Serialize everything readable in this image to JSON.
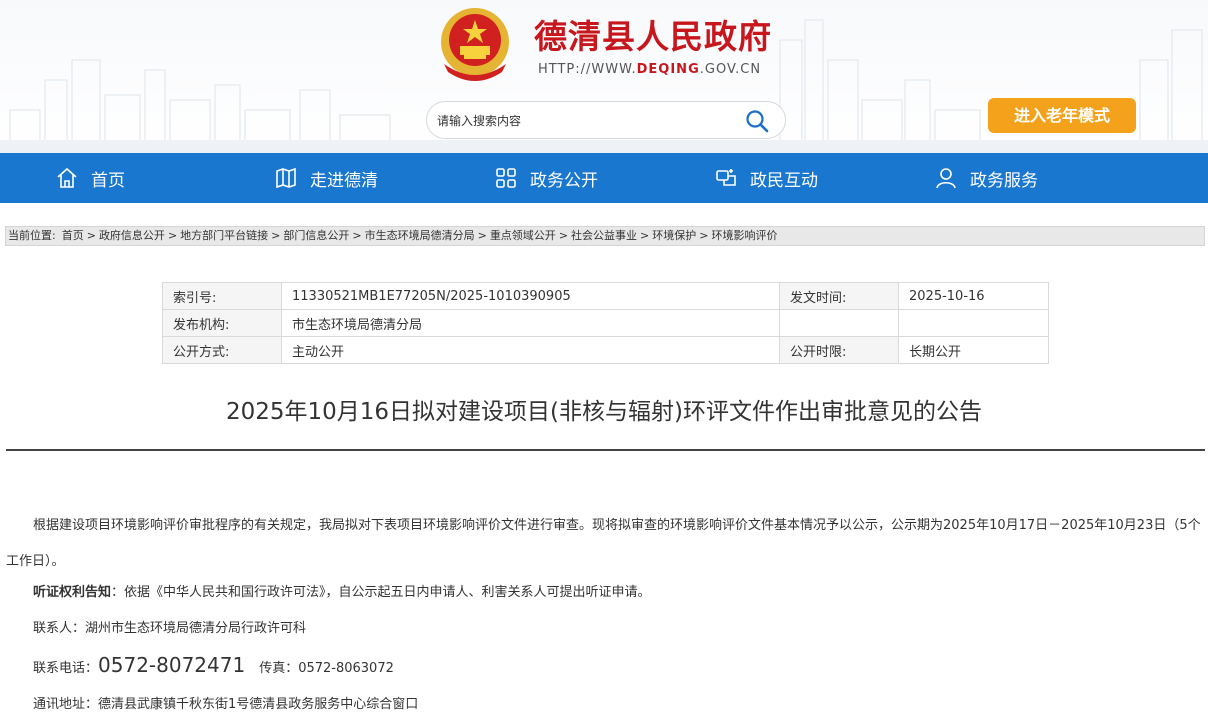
{
  "header": {
    "site_title": "德清县人民政府",
    "url_prefix": "HTTP://WWW.",
    "url_brand": "DEQING",
    "url_suffix": ".GOV.CN",
    "search_placeholder": "请输入搜索内容",
    "elder_mode": "进入老年模式"
  },
  "nav": {
    "items": [
      {
        "label": "首页",
        "icon": "home-icon"
      },
      {
        "label": "走进德清",
        "icon": "map-icon"
      },
      {
        "label": "政务公开",
        "icon": "grid-icon"
      },
      {
        "label": "政民互动",
        "icon": "interact-icon"
      },
      {
        "label": "政务服务",
        "icon": "user-icon"
      }
    ]
  },
  "breadcrumb": {
    "lead": "当前位置:",
    "items": [
      "首页",
      "政府信息公开",
      "地方部门平台链接",
      "部门信息公开",
      "市生态环境局德清分局",
      "重点领域公开",
      "社会公益事业",
      "环境保护",
      "环境影响评价"
    ],
    "separator": ">"
  },
  "info": {
    "index_label": "索引号:",
    "index_value": "11330521MB1E77205N/2025-1010390905",
    "date_label": "发文时间:",
    "date_value": "2025-10-16",
    "org_label": "发布机构:",
    "org_value": "市生态环境局德清分局",
    "mode_label": "公开方式:",
    "mode_value": "主动公开",
    "period_label": "公开时限:",
    "period_value": "长期公开"
  },
  "article": {
    "title": "2025年10月16日拟对建设项目(非核与辐射)环评文件作出审批意见的公告",
    "para1": "根据建设项目环境影响评价审批程序的有关规定，我局拟对下表项目环境影响评价文件进行审查。现将拟审查的环境影响评价文件基本情况予以公示，公示期为2025年10月17日－2025年10月23日（5个工作日）。",
    "hearing_label": "听证权利告知",
    "hearing_text": "：依据《中华人民共和国行政许可法》，自公示起五日内申请人、利害关系人可提出听证申请。",
    "contact": "联系人：湖州市生态环境局德清分局行政许可科",
    "phone_label": "联系电话：",
    "phone_value": "0572-8072471",
    "fax": "传真：0572-8063072",
    "address": "通讯地址：德清县武康镇千秋东街1号德清县政务服务中心综合窗口"
  },
  "colors": {
    "brand_red": "#c8161d",
    "nav_blue": "#1977cf",
    "elder_orange": "#f4a21c"
  }
}
